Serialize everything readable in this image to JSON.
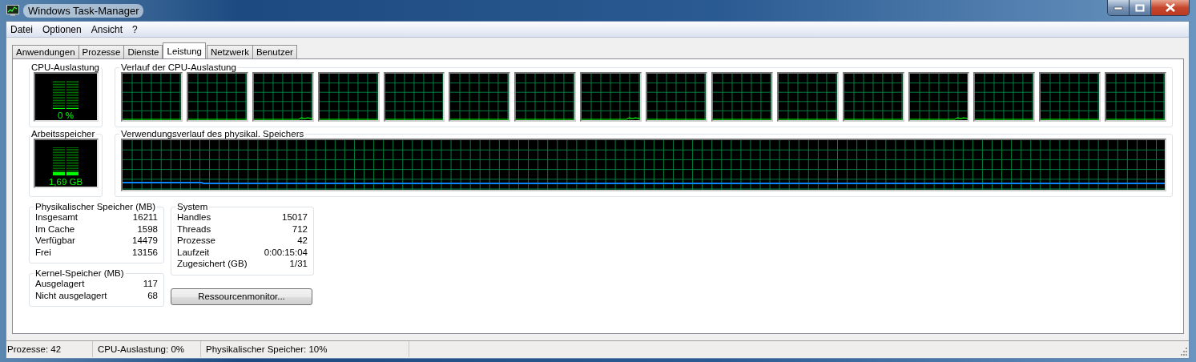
{
  "window": {
    "title": "Windows Task-Manager"
  },
  "menu": [
    "Datei",
    "Optionen",
    "Ansicht",
    "?"
  ],
  "tabs": [
    {
      "label": "Anwendungen",
      "selected": false
    },
    {
      "label": "Prozesse",
      "selected": false
    },
    {
      "label": "Dienste",
      "selected": false
    },
    {
      "label": "Leistung",
      "selected": true
    },
    {
      "label": "Netzwerk",
      "selected": false
    },
    {
      "label": "Benutzer",
      "selected": false
    }
  ],
  "cpu_usage": {
    "title": "CPU-Auslastung",
    "reading": "0 %",
    "level": 0
  },
  "cpu_history": {
    "title": "Verlauf der CPU-Auslastung",
    "graphs": [
      {
        "kind": "graph"
      },
      {
        "kind": "graph"
      },
      {
        "kind": "graph"
      },
      {
        "kind": "graph"
      },
      {
        "kind": "graph"
      },
      {
        "kind": "graph"
      },
      {
        "kind": "graph"
      },
      {
        "kind": "graph"
      },
      {
        "kind": "graph"
      },
      {
        "kind": "graph"
      },
      {
        "kind": "graph"
      },
      {
        "kind": "graph"
      },
      {
        "kind": "graph"
      },
      {
        "kind": "graph"
      },
      {
        "kind": "graph"
      },
      {
        "kind": "graph"
      }
    ]
  },
  "memory": {
    "title": "Arbeitsspeicher",
    "reading": "1,69 GB",
    "level": 0.1
  },
  "memory_history": {
    "title": "Verwendungsverlauf des physikal. Speichers"
  },
  "physical_memory": {
    "title": "Physikalischer Speicher (MB)",
    "rows": [
      {
        "label": "Insgesamt",
        "value": "16211"
      },
      {
        "label": "Im Cache",
        "value": "1598"
      },
      {
        "label": "Verfügbar",
        "value": "14479"
      },
      {
        "label": "Frei",
        "value": "13156"
      }
    ]
  },
  "kernel_memory": {
    "title": "Kernel-Speicher (MB)",
    "rows": [
      {
        "label": "Ausgelagert",
        "value": "117"
      },
      {
        "label": "Nicht ausgelagert",
        "value": "68"
      }
    ]
  },
  "system": {
    "title": "System",
    "rows": [
      {
        "label": "Handles",
        "value": "15017"
      },
      {
        "label": "Threads",
        "value": "712"
      },
      {
        "label": "Prozesse",
        "value": "42"
      },
      {
        "label": "Laufzeit",
        "value": "0:00:15:04"
      },
      {
        "label": "Zugesichert (GB)",
        "value": "1/31"
      }
    ]
  },
  "resource_monitor_button": "Ressourcenmonitor...",
  "status_bar": [
    "Prozesse: 42",
    "CPU-Auslastung: 0%",
    "Physikalischer Speicher: 10%"
  ]
}
